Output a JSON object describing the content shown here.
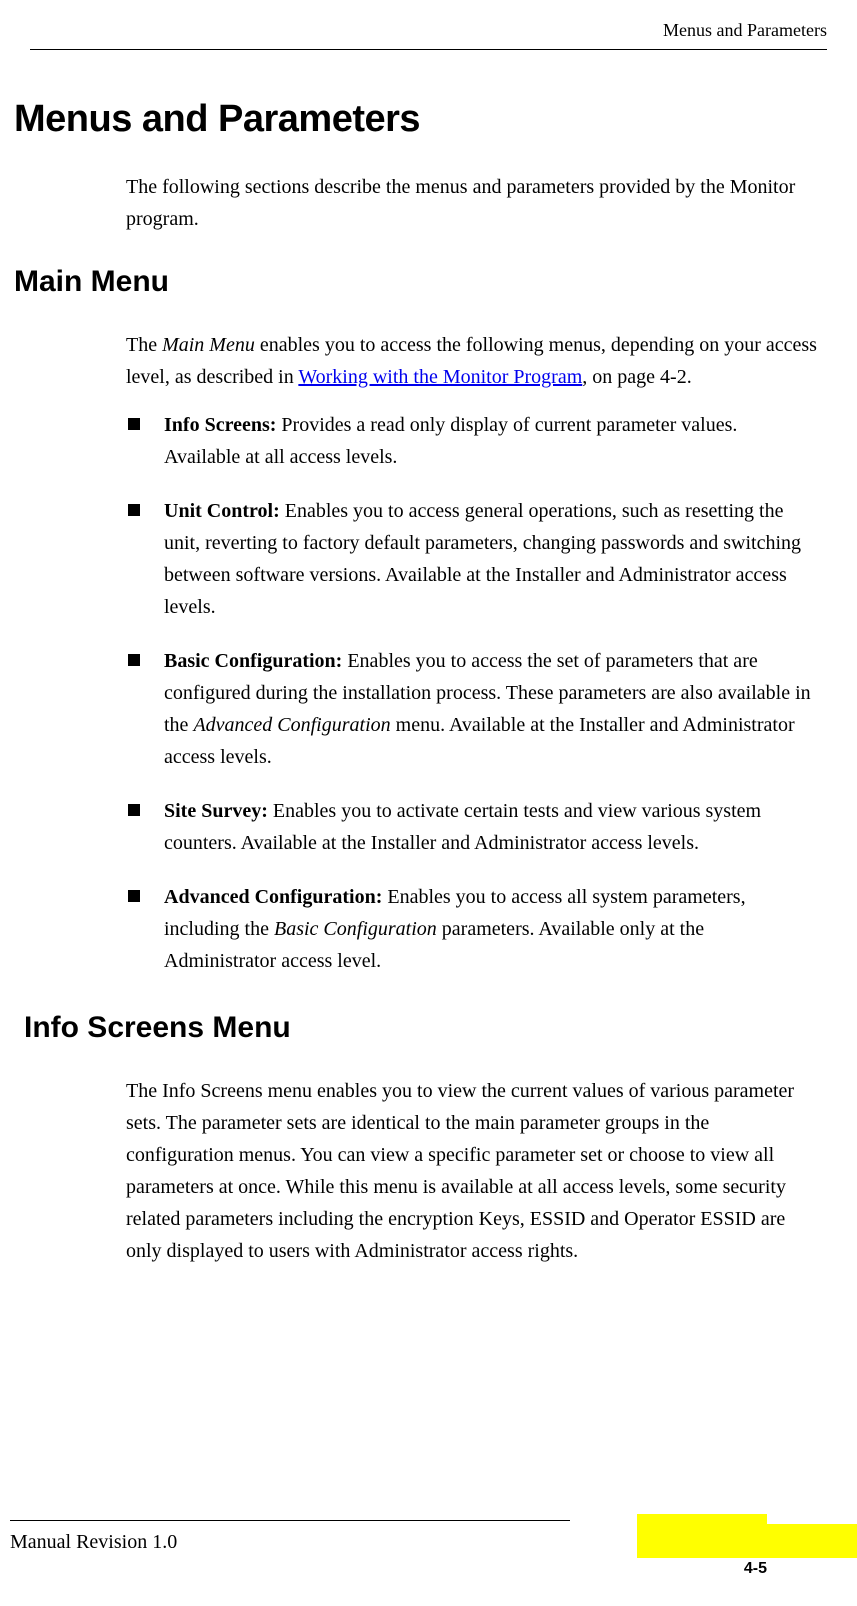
{
  "header": {
    "section_label": "Menus and Parameters"
  },
  "h1": "Menus and Parameters",
  "intro": "The following sections describe the menus and parameters provided by the Monitor program.",
  "h2_main": "Main Menu",
  "main_menu_intro_pre": "The ",
  "main_menu_intro_italic": "Main Menu",
  "main_menu_intro_mid": " enables you to access the following menus, depending on your access level, as described in ",
  "main_menu_intro_link": "Working with the Monitor Program",
  "main_menu_intro_post": ", on page 4-2.",
  "bullets": [
    {
      "label": "Info Screens:",
      "text": " Provides a read only display of current parameter values. Available at all access levels."
    },
    {
      "label": "Unit Control:",
      "text": " Enables you to access general operations, such as resetting the unit, reverting to factory default parameters, changing passwords and switching between software versions. Available at the Installer and Administrator access levels."
    },
    {
      "label": "Basic Configuration:",
      "text_pre": " Enables you to access the set of parameters that are configured during the installation process. These parameters are also available in the ",
      "text_italic": "Advanced Configuration",
      "text_post": " menu. Available at the Installer and Administrator access levels."
    },
    {
      "label": "Site Survey:",
      "text": " Enables you to activate certain tests and view various system counters. Available at the Installer and Administrator access levels."
    },
    {
      "label": "Advanced Configuration:",
      "text_pre": " Enables you to access all system parameters, including the ",
      "text_italic": "Basic Configuration",
      "text_post": " parameters. Available only at the Administrator access level."
    }
  ],
  "h2_info": "Info Screens Menu",
  "info_text": "The Info Screens menu enables you to view the current values of various parameter sets. The parameter sets are identical to the main parameter groups in the configuration menus. You can view a specific parameter set or choose to view all parameters at once. While this menu is available at all access levels, some security related parameters including the encryption Keys, ESSID and Operator ESSID are only displayed to users with Administrator access rights.",
  "footer": {
    "revision": "Manual Revision 1.0",
    "page_number": "4-5"
  }
}
